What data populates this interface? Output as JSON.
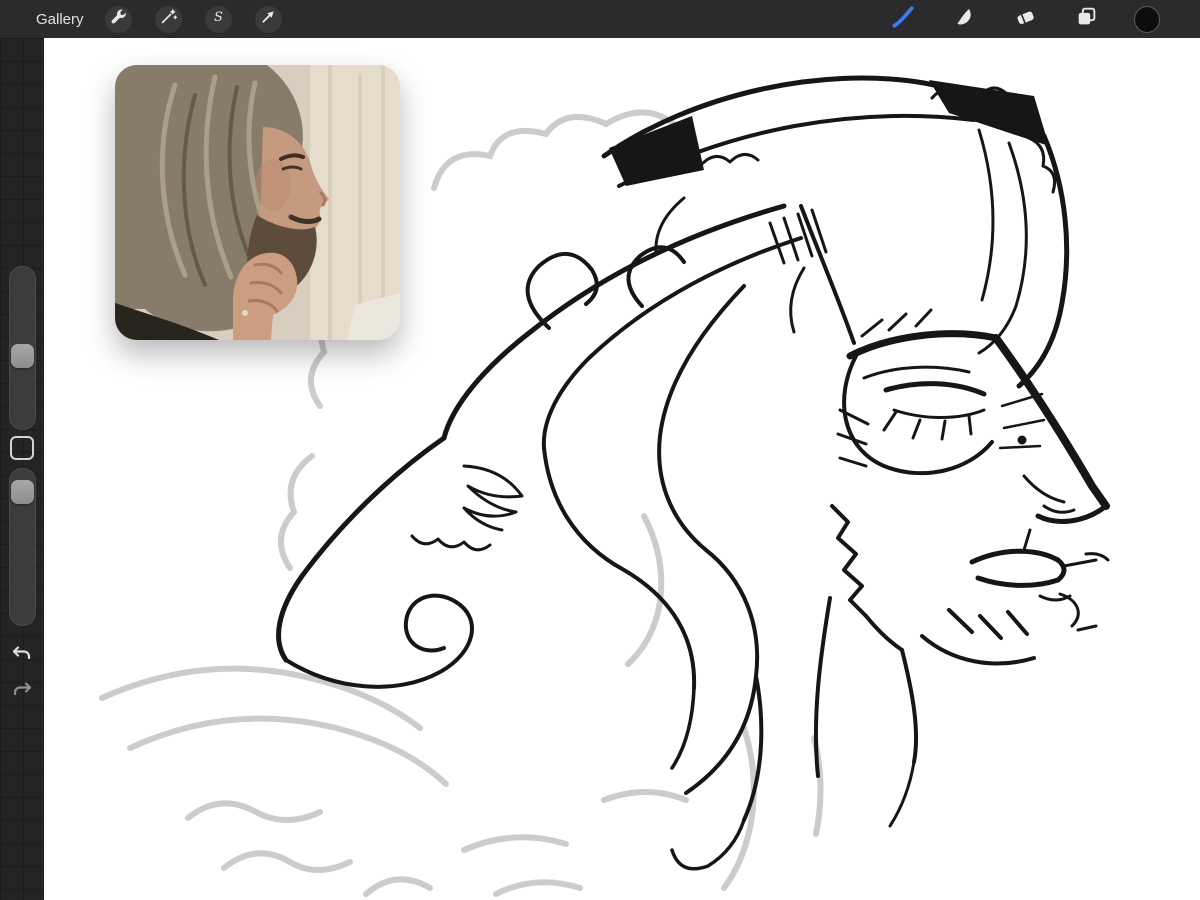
{
  "toolbar": {
    "gallery_label": "Gallery",
    "accent_color": "#3a7cf0",
    "current_color": "#0d0d0d",
    "left_tools": [
      {
        "id": "actions",
        "icon": "wrench-icon"
      },
      {
        "id": "adjustments",
        "icon": "magic-wand-icon"
      },
      {
        "id": "selection",
        "icon": "selection-s-icon",
        "glyph": "S"
      },
      {
        "id": "transform",
        "icon": "transform-arrow-icon"
      }
    ],
    "right_tools": [
      {
        "id": "paint",
        "icon": "paintbrush-icon",
        "active": true
      },
      {
        "id": "smudge",
        "icon": "smudge-icon"
      },
      {
        "id": "erase",
        "icon": "eraser-icon"
      },
      {
        "id": "layers",
        "icon": "layers-icon"
      },
      {
        "id": "color",
        "icon": "color-swatch"
      }
    ]
  },
  "sidebar": {
    "brush_size_slider": {
      "handle_pct": 56
    },
    "opacity_slider": {
      "handle_pct": 9
    }
  },
  "canvas": {
    "artwork_description": "Ink caricature sketch of a long-haired bearded man in right-facing profile with flowing wavy hair, dark cap band, and light gray pencil under-drawing of shoulders",
    "reference_description": "Reference photo thumbnail: man with long graying hair resting his hand on his bearded chin"
  }
}
